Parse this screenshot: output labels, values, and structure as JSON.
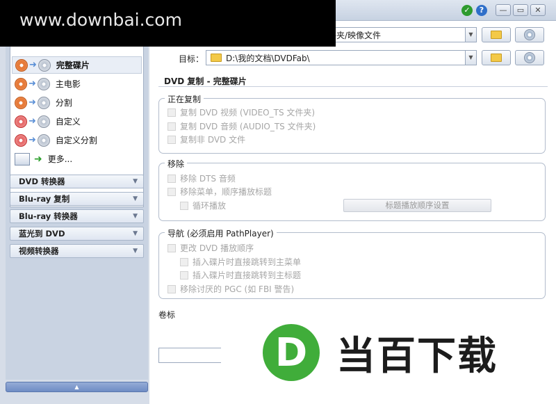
{
  "watermark": {
    "text": "www.downbai.com"
  },
  "titlebar": {
    "ok_glyph": "✓",
    "help_glyph": "?",
    "min_glyph": "—",
    "max_glyph": "▭",
    "close_glyph": "✕"
  },
  "source": {
    "value_partial": "件夹/映像文件"
  },
  "target": {
    "label": "目标：",
    "value": "D:\\我的文档\\DVDFab\\"
  },
  "sidebar": {
    "items": [
      {
        "label": "完整碟片",
        "icon": "disc-full-icon"
      },
      {
        "label": "主电影",
        "icon": "disc-main-movie-icon"
      },
      {
        "label": "分割",
        "icon": "disc-split-icon"
      },
      {
        "label": "自定义",
        "icon": "disc-custom-icon"
      },
      {
        "label": "自定义分割",
        "icon": "disc-custom-split-icon"
      },
      {
        "label": "更多...",
        "icon": "more-list-icon"
      }
    ],
    "accordions": [
      {
        "label": "DVD 转换器"
      },
      {
        "label": "Blu-ray 复制"
      },
      {
        "label": "Blu-ray 转换器"
      },
      {
        "label": "蓝光到 DVD"
      },
      {
        "label": "视频转换器"
      }
    ],
    "scroll_glyph": "▲"
  },
  "main": {
    "section_title": "DVD 复制 - 完整碟片",
    "copying": {
      "title": "正在复制",
      "options": [
        "复制 DVD 视频 (VIDEO_TS 文件夹)",
        "复制 DVD 音频 (AUDIO_TS 文件夹)",
        "复制非 DVD 文件"
      ]
    },
    "remove": {
      "title": "移除",
      "options": [
        "移除 DTS 音频",
        "移除菜单，顺序播放标题"
      ],
      "sub_option": "循环播放",
      "button": "标题播放顺序设置"
    },
    "navigation": {
      "title": "导航 (必须启用 PathPlayer)",
      "options": [
        "更改 DVD 播放顺序"
      ],
      "sub_options": [
        "插入碟片时直接跳转到主菜单",
        "插入碟片时直接跳转到主标题"
      ],
      "options2": [
        "移除讨厌的 PGC (如 FBI 警告)"
      ]
    },
    "volume_label": "卷标"
  },
  "logo": {
    "mark_letter": "D",
    "text": "当百下载",
    "brand_color": "#40ad3a"
  }
}
